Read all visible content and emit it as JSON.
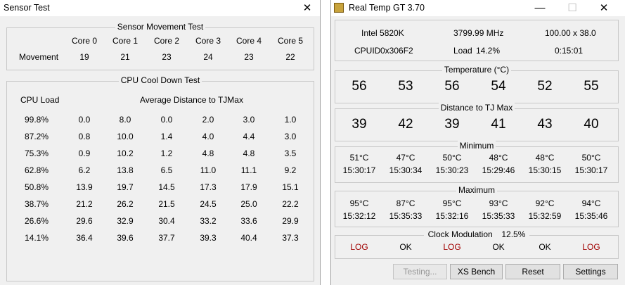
{
  "sensor_test": {
    "title": "Sensor Test",
    "close_glyph": "✕",
    "movement_title": "Sensor Movement Test",
    "cores": [
      "Core 0",
      "Core 1",
      "Core 2",
      "Core 3",
      "Core 4",
      "Core 5"
    ],
    "movement_label": "Movement",
    "movement": [
      "19",
      "21",
      "23",
      "24",
      "23",
      "22"
    ],
    "cooldown_title": "CPU Cool Down Test",
    "cpu_load_header": "CPU Load",
    "avg_header": "Average Distance to TJMax",
    "rows": [
      {
        "load": "99.8%",
        "v": [
          "0.0",
          "8.0",
          "0.0",
          "2.0",
          "3.0",
          "1.0"
        ]
      },
      {
        "load": "87.2%",
        "v": [
          "0.8",
          "10.0",
          "1.4",
          "4.0",
          "4.4",
          "3.0"
        ]
      },
      {
        "load": "75.3%",
        "v": [
          "0.9",
          "10.2",
          "1.2",
          "4.8",
          "4.8",
          "3.5"
        ]
      },
      {
        "load": "62.8%",
        "v": [
          "6.2",
          "13.8",
          "6.5",
          "11.0",
          "11.1",
          "9.2"
        ]
      },
      {
        "load": "50.8%",
        "v": [
          "13.9",
          "19.7",
          "14.5",
          "17.3",
          "17.9",
          "15.1"
        ]
      },
      {
        "load": "38.7%",
        "v": [
          "21.2",
          "26.2",
          "21.5",
          "24.5",
          "25.0",
          "22.2"
        ]
      },
      {
        "load": "26.6%",
        "v": [
          "29.6",
          "32.9",
          "30.4",
          "33.2",
          "33.6",
          "29.9"
        ]
      },
      {
        "load": "14.1%",
        "v": [
          "36.4",
          "39.6",
          "37.7",
          "39.3",
          "40.4",
          "37.3"
        ]
      }
    ]
  },
  "realtemp": {
    "title": "Real Temp GT 3.70",
    "min_glyph": "—",
    "max_glyph": "☐",
    "close_glyph": "✕",
    "cpu": "Intel 5820K",
    "mhz": "3799.99 MHz",
    "mult": "100.00 x 38.0",
    "cpuid_label": "CPUID",
    "cpuid": "0x306F2",
    "load_label": "Load",
    "load": "14.2%",
    "uptime": "0:15:01",
    "temp_title": "Temperature (°C)",
    "temps": [
      "56",
      "53",
      "56",
      "54",
      "52",
      "55"
    ],
    "dist_title": "Distance to TJ Max",
    "dist": [
      "39",
      "42",
      "39",
      "41",
      "43",
      "40"
    ],
    "min_title": "Minimum",
    "min_temps": [
      "51°C",
      "47°C",
      "50°C",
      "48°C",
      "48°C",
      "50°C"
    ],
    "min_times": [
      "15:30:17",
      "15:30:34",
      "15:30:23",
      "15:29:46",
      "15:30:15",
      "15:30:17"
    ],
    "max_title": "Maximum",
    "max_temps": [
      "95°C",
      "87°C",
      "95°C",
      "93°C",
      "92°C",
      "94°C"
    ],
    "max_times": [
      "15:32:12",
      "15:35:33",
      "15:32:16",
      "15:35:33",
      "15:32:59",
      "15:35:46"
    ],
    "clock_title": "Clock Modulation",
    "clock_value": "12.5%",
    "status": [
      "LOG",
      "OK",
      "LOG",
      "OK",
      "OK",
      "LOG"
    ],
    "buttons": {
      "testing": "Testing...",
      "xs_bench": "XS Bench",
      "reset": "Reset",
      "settings": "Settings"
    },
    "colors": {
      "log": "#a00000"
    }
  }
}
